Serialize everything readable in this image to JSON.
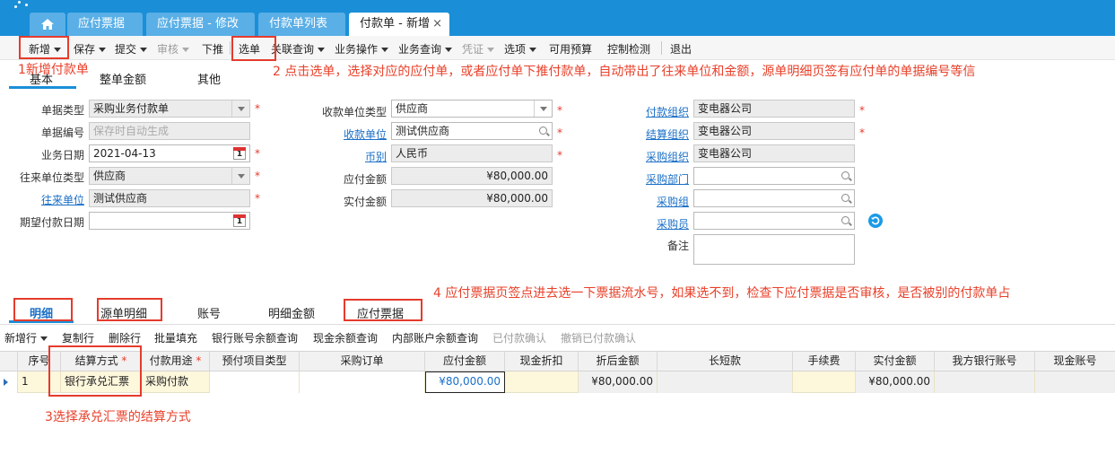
{
  "tabs": [
    {
      "label": "应付票据"
    },
    {
      "label": "应付票据 - 修改"
    },
    {
      "label": "付款单列表"
    },
    {
      "label": "付款单 - 新增"
    }
  ],
  "toolbar": {
    "items": [
      "新增",
      "保存",
      "提交",
      "审核",
      "下推",
      "选单",
      "关联查询",
      "业务操作",
      "业务查询",
      "凭证",
      "选项",
      "可用预算",
      "控制检测",
      "退出"
    ]
  },
  "form_tabs": [
    "基本",
    "整单金额",
    "其他"
  ],
  "annotations": {
    "a1": "1新增付款单",
    "a2": "2 点击选单，选择对应的应付单，或者应付单下推付款单，自动带出了往来单位和金额，源单明细页签有应付单的单据编号等信",
    "a3": "3选择承兑汇票的结算方式",
    "a4": "4 应付票据页签点进去选一下票据流水号，如果选不到，检查下应付票据是否审核，是否被别的付款单占"
  },
  "form": {
    "doc_type_label": "单据类型",
    "doc_type_value": "采购业务付款单",
    "doc_no_label": "单据编号",
    "doc_no_placeholder": "保存时自动生成",
    "biz_date_label": "业务日期",
    "biz_date_value": "2021-04-13",
    "contact_type_label": "往来单位类型",
    "contact_type_value": "供应商",
    "contact_label": "往来单位",
    "contact_value": "测试供应商",
    "expect_date_label": "期望付款日期",
    "expect_date_value": "",
    "payee_type_label": "收款单位类型",
    "payee_type_value": "供应商",
    "payee_label": "收款单位",
    "payee_value": "测试供应商",
    "currency_label": "币别",
    "currency_value": "人民币",
    "payable_label": "应付金额",
    "payable_value": "¥80,000.00",
    "paid_label": "实付金额",
    "paid_value": "¥80,000.00",
    "pay_org_label": "付款组织",
    "pay_org_value": "变电器公司",
    "settle_org_label": "结算组织",
    "settle_org_value": "变电器公司",
    "purchase_org_label": "采购组织",
    "purchase_org_value": "变电器公司",
    "purchase_dept_label": "采购部门",
    "purchase_dept_value": "",
    "purchase_group_label": "采购组",
    "purchase_group_value": "",
    "purchaser_label": "采购员",
    "purchaser_value": "",
    "remark_label": "备注",
    "remark_value": ""
  },
  "detail_tabs": [
    "明细",
    "源单明细",
    "账号",
    "明细金额",
    "应付票据"
  ],
  "grid_toolbar": [
    "新增行",
    "复制行",
    "删除行",
    "批量填充",
    "银行账号余额查询",
    "现金余额查询",
    "内部账户余额查询",
    "已付款确认",
    "撤销已付款确认"
  ],
  "grid": {
    "columns": [
      "序号",
      "结算方式",
      "付款用途",
      "预付项目类型",
      "采购订单",
      "应付金额",
      "现金折扣",
      "折后金额",
      "长短款",
      "手续费",
      "实付金额",
      "我方银行账号",
      "现金账号"
    ],
    "rows": [
      {
        "seq": "1",
        "settle": "银行承兑汇票",
        "use": "采购付款",
        "prepay": "",
        "po": "",
        "payable": "¥80,000.00",
        "discount": "",
        "after": "¥80,000.00",
        "over": "",
        "fee": "",
        "paid": "¥80,000.00",
        "bank": "",
        "cash": ""
      }
    ]
  },
  "colors": {
    "accent": "#1a8fd8",
    "annotation": "#e53b2c",
    "link": "#1a6fc7"
  }
}
